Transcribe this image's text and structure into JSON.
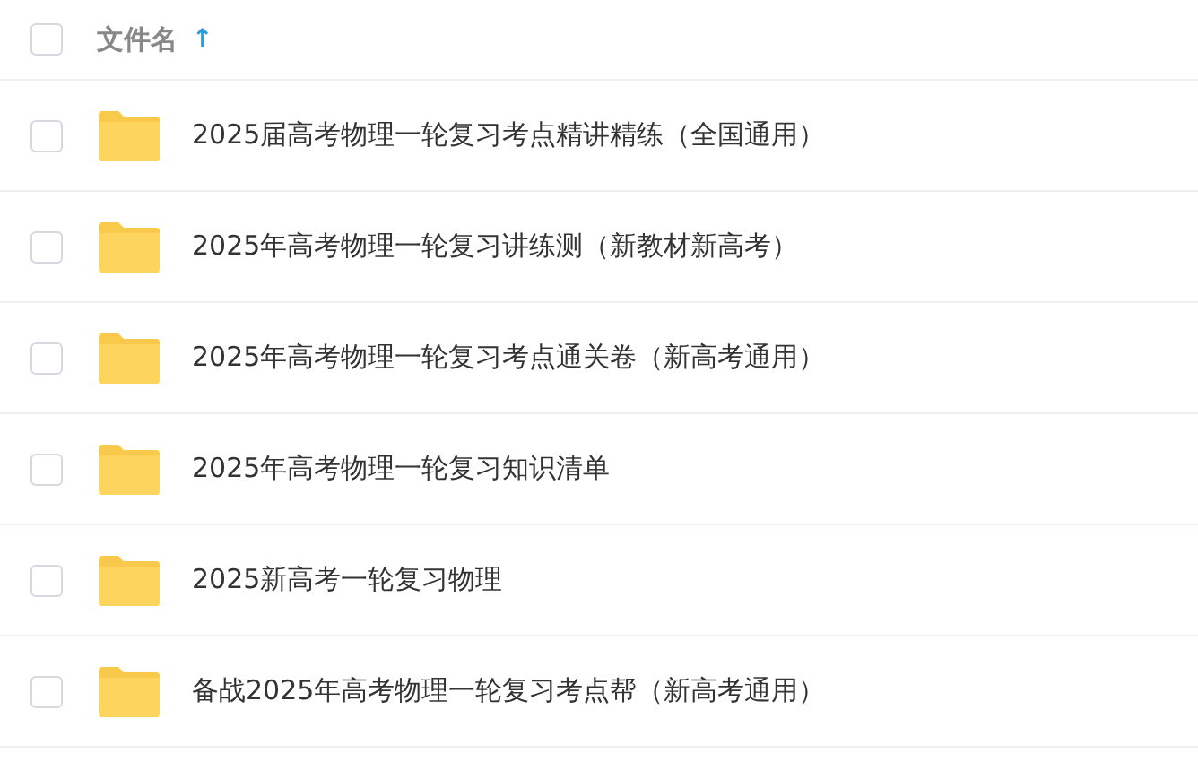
{
  "header": {
    "label": "文件名",
    "sort_arrow": "↑",
    "checked": false
  },
  "files": [
    {
      "name": "2025届高考物理一轮复习考点精讲精练（全国通用）",
      "checked": false
    },
    {
      "name": "2025年高考物理一轮复习讲练测（新教材新高考）",
      "checked": false
    },
    {
      "name": "2025年高考物理一轮复习考点通关卷（新高考通用）",
      "checked": false
    },
    {
      "name": "2025年高考物理一轮复习知识清单",
      "checked": false
    },
    {
      "name": "2025新高考一轮复习物理",
      "checked": false
    },
    {
      "name": "备战2025年高考物理一轮复习考点帮（新高考通用）",
      "checked": false
    }
  ]
}
